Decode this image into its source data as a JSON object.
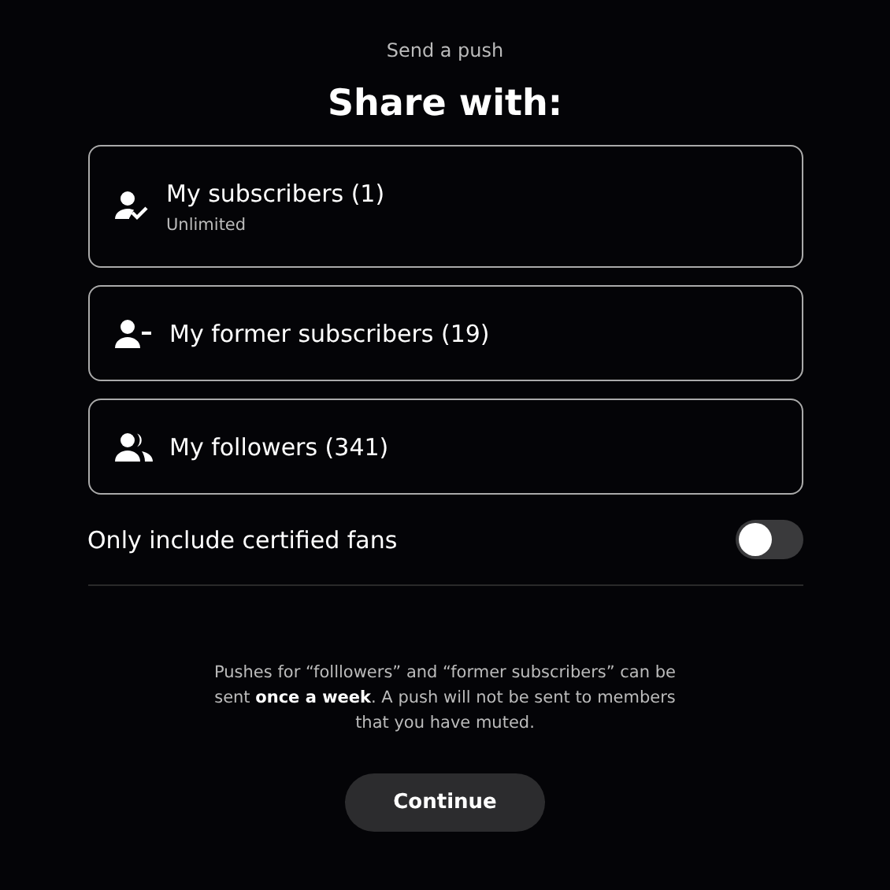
{
  "header": {
    "subtitle": "Send a push",
    "title": "Share with:"
  },
  "options": [
    {
      "kind": "subscribers",
      "label": "My subscribers (1)",
      "sublabel": "Unlimited"
    },
    {
      "kind": "former",
      "label": "My former subscribers (19)"
    },
    {
      "kind": "followers",
      "label": "My followers (341)"
    }
  ],
  "certified_toggle": {
    "label": "Only include certified fans",
    "on": false
  },
  "note": "Pushes for “folllowers” and “former subscribers” can be sent **once a week**. A push will not be sent to members that you have muted.",
  "continue_button": "Continue"
}
